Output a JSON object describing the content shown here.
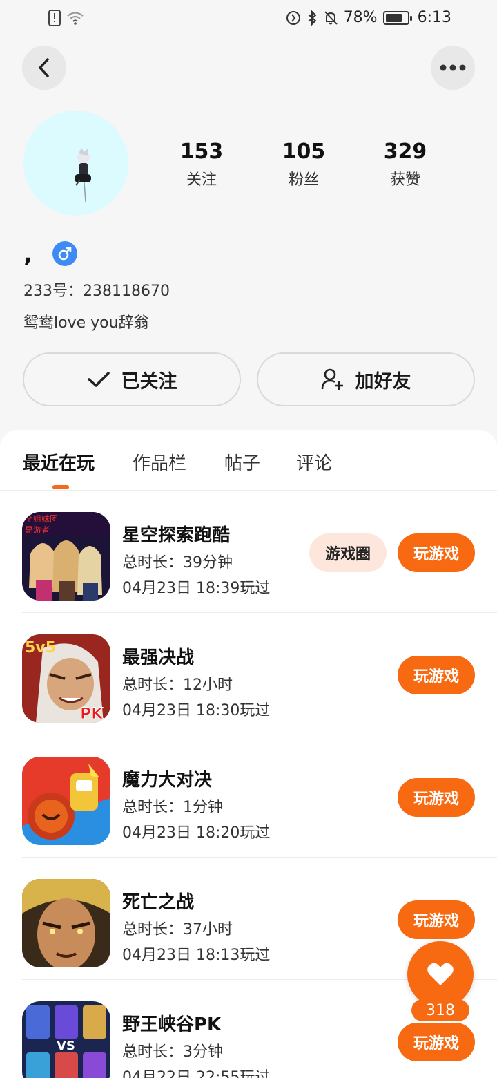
{
  "status": {
    "battery": "78%",
    "battery_level": 0.78,
    "time": "6:13"
  },
  "profile": {
    "nickname": ",",
    "uid": "233号：238118670",
    "bio": "鸳鸯love you辞翁",
    "stats": [
      {
        "value": "153",
        "label": "关注"
      },
      {
        "value": "105",
        "label": "粉丝"
      },
      {
        "value": "329",
        "label": "获赞"
      }
    ]
  },
  "actions": {
    "followed_label": "已关注",
    "add_friend_label": "加好友"
  },
  "tabs": [
    "最近在玩",
    "作品栏",
    "帖子",
    "评论"
  ],
  "games": [
    {
      "name": "星空探索跑酷",
      "duration": "总时长：39分钟",
      "last_played": "04月23日 18:39玩过",
      "circle_label": "游戏圈",
      "play_label": "玩游戏"
    },
    {
      "name": "最强决战",
      "duration": "总时长：12小时",
      "last_played": "04月23日 18:30玩过",
      "play_label": "玩游戏"
    },
    {
      "name": "魔力大对决",
      "duration": "总时长：1分钟",
      "last_played": "04月23日 18:20玩过",
      "play_label": "玩游戏"
    },
    {
      "name": "死亡之战",
      "duration": "总时长：37小时",
      "last_played": "04月23日 18:13玩过",
      "play_label": "玩游戏"
    },
    {
      "name": "野王峡谷PK",
      "duration": "总时长：3分钟",
      "last_played": "04月22日 22:55玩过",
      "play_label": "玩游戏"
    }
  ],
  "like": {
    "count": "318"
  },
  "colors": {
    "accent": "#f86a12",
    "gender_badge": "#3f8bf5",
    "avatar_bg": "#dcfbfe"
  }
}
